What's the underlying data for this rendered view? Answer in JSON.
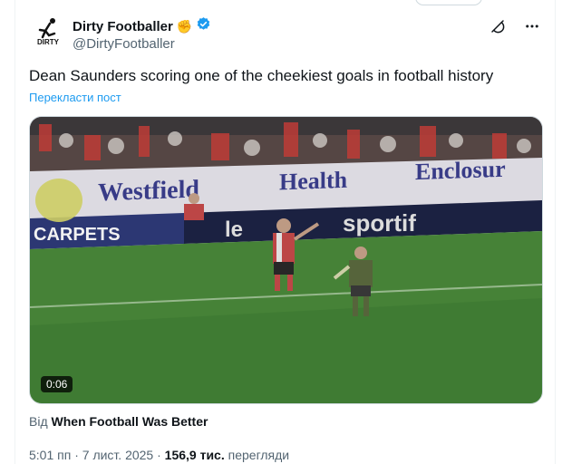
{
  "author": {
    "name": "Dirty Footballer",
    "emoji": "✊",
    "handle": "@DirtyFootballer",
    "avatar_text": "DIRTY"
  },
  "post": {
    "text": "Dean Saunders scoring one of the cheekiest goals in football history",
    "translate_label": "Перекласти пост"
  },
  "video": {
    "duration": "0:06",
    "boards": {
      "top_left": "Westfield",
      "top_mid": "Health",
      "top_right": "Enclosur",
      "bottom_left": "CARPETS",
      "bottom_mid1": "le",
      "bottom_mid2": "sportif"
    }
  },
  "source": {
    "prefix": "Від",
    "name": "When Football Was Better"
  },
  "meta": {
    "time": "5:01 пп",
    "sep": "·",
    "date": "7 лист. 2025",
    "sep2": "·",
    "views": "156,9 тис.",
    "views_label": "перегляди"
  },
  "colors": {
    "link": "#1d9bf0",
    "verified": "#1d9bf0",
    "muted": "#536471"
  }
}
